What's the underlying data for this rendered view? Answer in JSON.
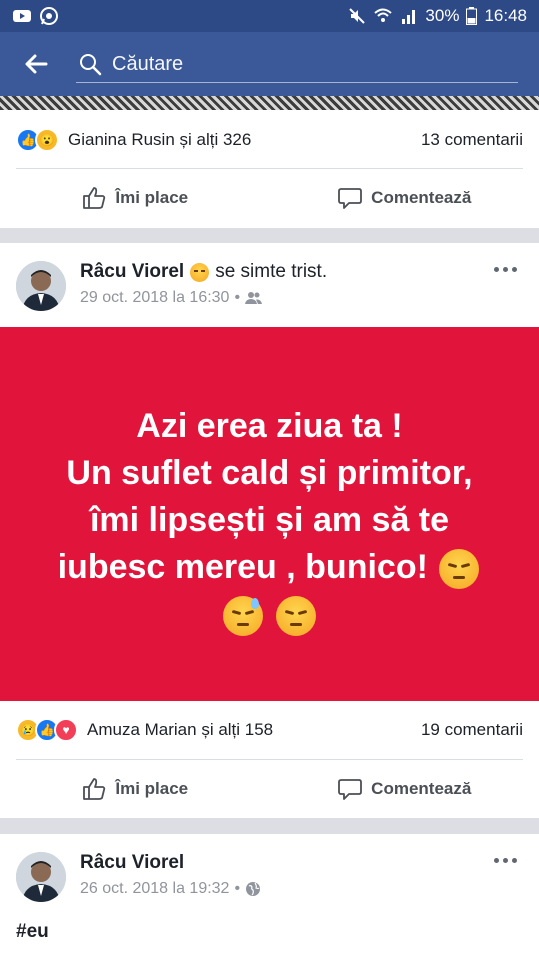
{
  "status_bar": {
    "battery": "30%",
    "time": "16:48"
  },
  "search": {
    "placeholder": "Căutare"
  },
  "post1": {
    "reactions_text": "Gianina Rusin și alți 326",
    "comments": "13 comentarii",
    "like_label": "Îmi place",
    "comment_label": "Comentează"
  },
  "post2": {
    "author": "Râcu Viorel",
    "feeling": "se simte trist.",
    "timestamp": "29 oct. 2018 la 16:30",
    "privacy_icon": "friends-icon",
    "text_lines": [
      "Azi erea ziua ta !",
      "Un suflet cald și primitor,",
      "îmi lipsești și am să te",
      "iubesc mereu , bunico!"
    ],
    "background_color": "#e1143c",
    "reactions_text": "Amuza Marian și alți 158",
    "comments": "19 comentarii",
    "like_label": "Îmi place",
    "comment_label": "Comentează"
  },
  "post3": {
    "author": "Râcu Viorel",
    "timestamp": "26 oct. 2018 la 19:32",
    "privacy_icon": "globe-icon",
    "text": "#eu"
  },
  "colors": {
    "brand": "#3b5998",
    "status_bar": "#2d4a86",
    "like_blue": "#1877f2",
    "love_red": "#f33e58"
  }
}
